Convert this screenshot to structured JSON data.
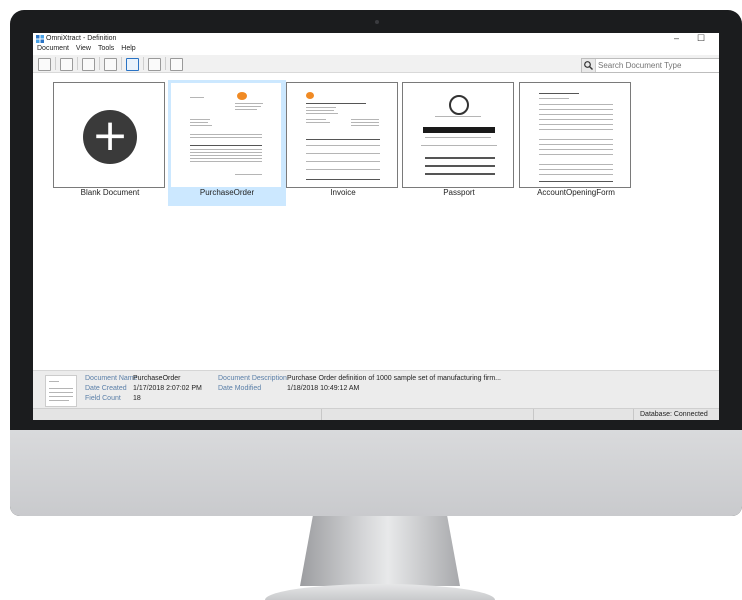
{
  "window": {
    "title": "OmniXtract - Definition",
    "minimize_glyph": "–",
    "maximize_glyph": "☐"
  },
  "menu": {
    "items": [
      "Document",
      "View",
      "Tools",
      "Help"
    ]
  },
  "toolbar": {
    "icons": [
      "new-icon",
      "save-icon",
      "open-folder-icon",
      "properties-icon",
      "refresh-icon",
      "copy-icon",
      "delete-icon"
    ]
  },
  "search": {
    "placeholder": "Search Document Type",
    "value": ""
  },
  "cards": [
    {
      "label": "Blank Document",
      "plus": "+"
    },
    {
      "label": "PurchaseOrder",
      "selected": true
    },
    {
      "label": "Invoice"
    },
    {
      "label": "Passport"
    },
    {
      "label": "AccountOpeningForm"
    }
  ],
  "details": {
    "name_label": "Document Name",
    "name_value": "PurchaseOrder",
    "created_label": "Date Created",
    "created_value": "1/17/2018 2:07:02 PM",
    "field_label": "Field Count",
    "field_value": "18",
    "desc_label": "Document Description",
    "desc_value": "Purchase Order definition of 1000 sample set of manufacturing firm...",
    "modified_label": "Date Modified",
    "modified_value": "1/18/2018 10:49:12 AM"
  },
  "status": {
    "database": "Database: Connected"
  }
}
